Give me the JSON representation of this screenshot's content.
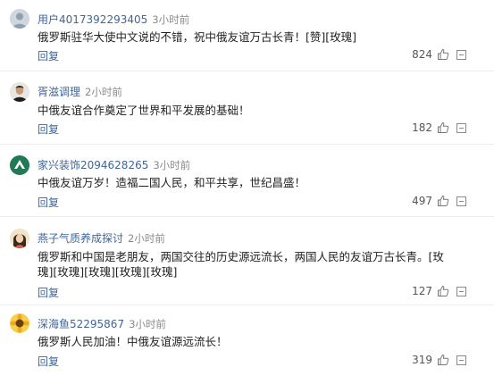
{
  "comments": [
    {
      "username": "用户4017392293405",
      "time": "3小时前",
      "text": "俄罗斯驻华大使中文说的不错，祝中俄友谊万古长青！[赞][玫瑰]",
      "reply_label": "回复",
      "likes": "824",
      "avatar_icon": "default-avatar-icon"
    },
    {
      "username": "胥滋调理",
      "time": "2小时前",
      "text": "中俄友谊合作奠定了世界和平发展的基础！",
      "reply_label": "回复",
      "likes": "182",
      "avatar_icon": "person-photo-avatar-icon"
    },
    {
      "username": "家兴装饰2094628265",
      "time": "3小时前",
      "text": "中俄友谊万岁！造福二国人民，和平共享，世纪昌盛！",
      "reply_label": "回复",
      "likes": "497",
      "avatar_icon": "green-logo-avatar-icon"
    },
    {
      "username": "燕子气质养成探讨",
      "time": "2小时前",
      "text": "俄罗斯和中国是老朋友，两国交往的历史源远流长，两国人民的友谊万古长青。[玫瑰][玫瑰][玫瑰][玫瑰][玫瑰]",
      "reply_label": "回复",
      "likes": "127",
      "avatar_icon": "girl-avatar-icon"
    },
    {
      "username": "深海鱼52295867",
      "time": "3小时前",
      "text": "俄罗斯人民加油！中俄友谊源远流长！",
      "reply_label": "回复",
      "likes": "319",
      "avatar_icon": "sunflower-avatar-icon"
    }
  ],
  "colors": {
    "username": "#406599",
    "reply": "#406599",
    "time": "#8a8a8a",
    "text": "#222222",
    "divider": "#ececec"
  }
}
